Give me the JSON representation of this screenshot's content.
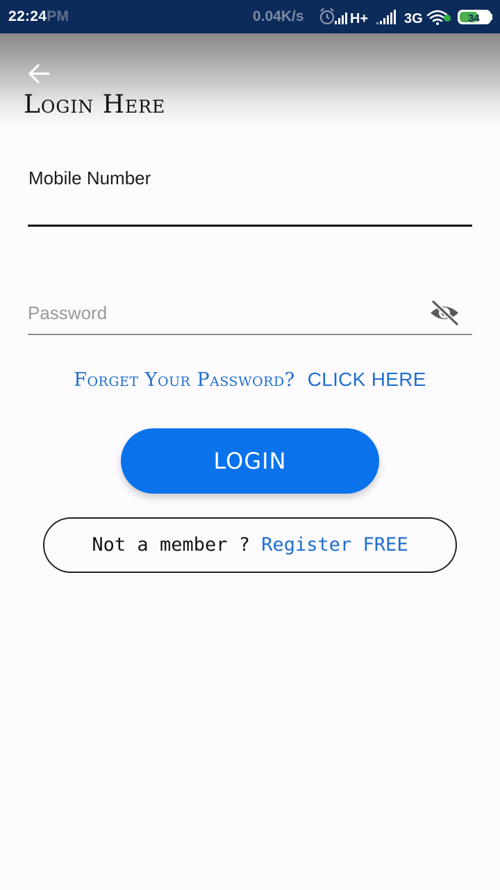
{
  "status_bar": {
    "time": "22:24",
    "ampm": "PM",
    "network_speed": "0.04K/s",
    "network_type_1": "H+",
    "network_type_2": "3G",
    "battery": "34"
  },
  "header": {
    "title": "Login Here",
    "back_icon": "arrow-left-icon"
  },
  "form": {
    "mobile_label": "Mobile Number",
    "mobile_value": "",
    "password_placeholder": "Password",
    "password_value": "",
    "visibility_icon": "eye-off-icon"
  },
  "forgot": {
    "text": "Forget Your Password?",
    "link": "CLICK HERE"
  },
  "login_button": "LOGIN",
  "register": {
    "prompt": "Not a member ?",
    "link": "Register FREE"
  },
  "colors": {
    "status_bar": "#0d2b5a",
    "accent_blue": "#0a73ec",
    "link_blue": "#1f6fcd",
    "background": "#fdfbfe"
  }
}
